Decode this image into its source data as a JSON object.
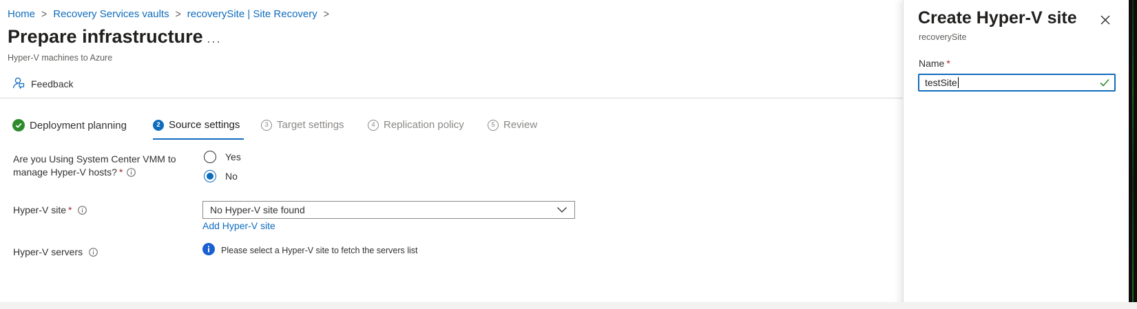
{
  "breadcrumb": {
    "items": [
      "Home",
      "Recovery Services vaults",
      "recoverySite | Site Recovery"
    ]
  },
  "page": {
    "title": "Prepare infrastructure",
    "more": "···",
    "subtitle": "Hyper-V machines to Azure"
  },
  "toolbar": {
    "feedback_label": "Feedback"
  },
  "wizard": {
    "steps": [
      {
        "label": "Deployment planning",
        "state": "complete"
      },
      {
        "number": "2",
        "label": "Source settings",
        "state": "active"
      },
      {
        "number": "3",
        "label": "Target settings",
        "state": "pending"
      },
      {
        "number": "4",
        "label": "Replication policy",
        "state": "pending"
      },
      {
        "number": "5",
        "label": "Review",
        "state": "pending"
      }
    ]
  },
  "form": {
    "vmm_question": {
      "label_line1": "Are you Using System Center VMM to",
      "label_line2": "manage Hyper-V hosts?",
      "required": "*",
      "options": [
        {
          "label": "Yes",
          "checked": false
        },
        {
          "label": "No",
          "checked": true
        }
      ]
    },
    "hyperv_site": {
      "label": "Hyper-V site",
      "required": "*",
      "value": "No Hyper-V site found",
      "add_link": "Add Hyper-V site"
    },
    "hyperv_servers": {
      "label": "Hyper-V servers",
      "message": "Please select a Hyper-V site to fetch the servers list"
    }
  },
  "blade": {
    "title": "Create Hyper-V site",
    "subtitle": "recoverySite",
    "name_label": "Name",
    "required": "*",
    "name_value": "testSite"
  },
  "colors": {
    "accent": "#0f6cbd",
    "success": "#2e8b2b",
    "required": "#a4262c"
  }
}
